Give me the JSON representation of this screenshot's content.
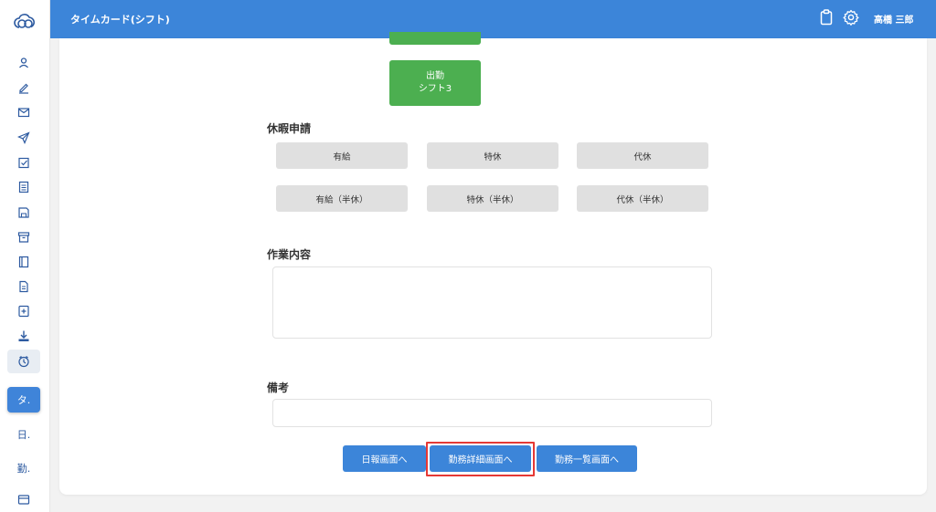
{
  "header": {
    "title": "タイムカード(シフト)",
    "user_name": "高橋 三郎"
  },
  "sidebar": {
    "text_items": [
      {
        "label": "タ.",
        "active": true
      },
      {
        "label": "日."
      },
      {
        "label": "勤."
      }
    ]
  },
  "attendance": {
    "shift_button": {
      "line1": "出勤",
      "line2": "シフト3"
    }
  },
  "leave": {
    "title": "休暇申請",
    "buttons": [
      "有給",
      "特休",
      "代休",
      "有給（半休）",
      "特休（半休）",
      "代休（半休）"
    ]
  },
  "work": {
    "title": "作業内容",
    "value": ""
  },
  "notes": {
    "title": "備考",
    "value": ""
  },
  "footer": {
    "daily_report_label": "日報画面へ",
    "work_detail_label": "勤務詳細画面へ",
    "work_list_label": "勤務一覧画面へ"
  },
  "colors": {
    "header": "#3c85d9",
    "green": "#4caf50",
    "gray_button": "#e0e0e0",
    "highlight": "#e53935"
  }
}
